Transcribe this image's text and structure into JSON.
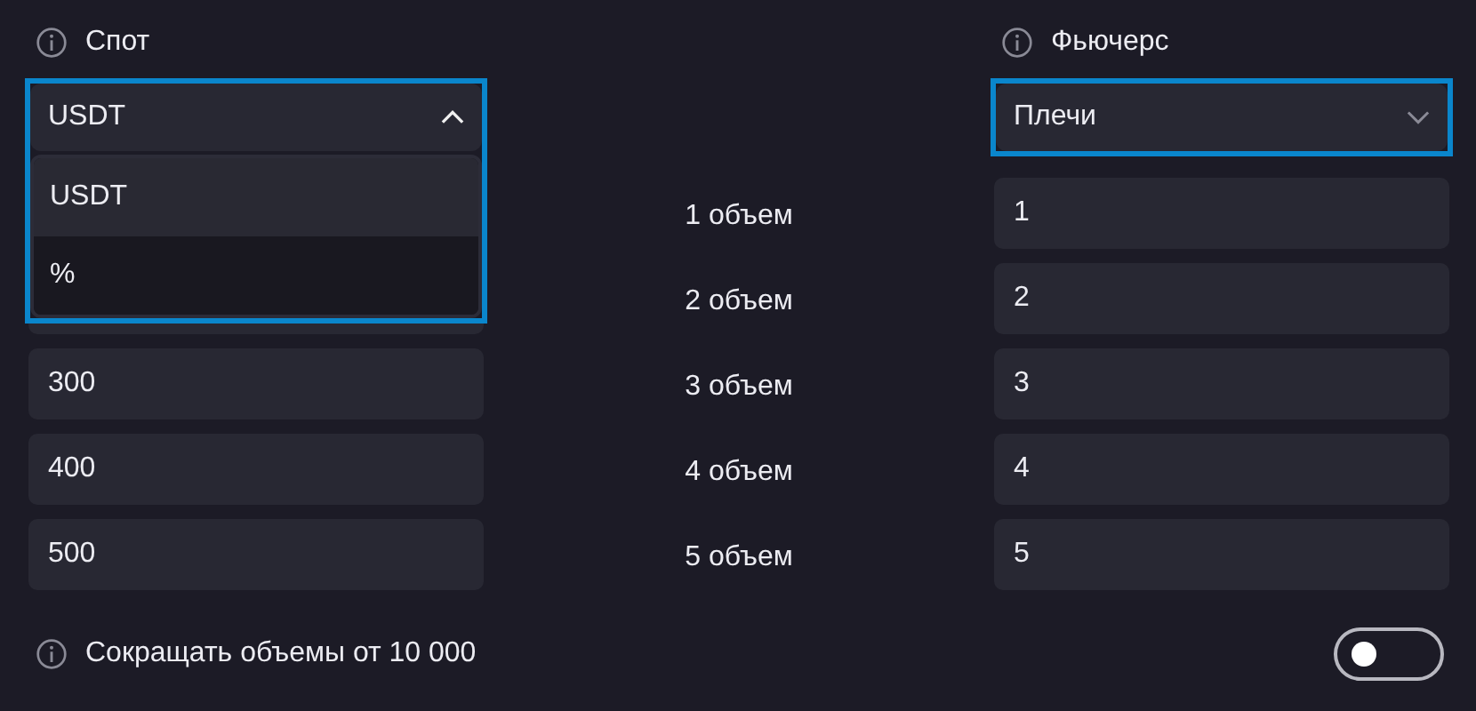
{
  "spot": {
    "label": "Спот",
    "select": {
      "value": "USDT",
      "expanded": true,
      "options": [
        {
          "label": "USDT",
          "selected": true
        },
        {
          "label": "%",
          "selected": false
        }
      ]
    },
    "values": [
      "300",
      "400",
      "500"
    ]
  },
  "rows": [
    "1 объем",
    "2 объем",
    "3 объем",
    "4 объем",
    "5 объем"
  ],
  "futures": {
    "label": "Фьючерс",
    "select": {
      "value": "Плечи",
      "expanded": false
    },
    "values": [
      "1",
      "2",
      "3",
      "4",
      "5"
    ]
  },
  "reduce": {
    "label": "Сокращать объемы от 10 000",
    "on": false
  }
}
